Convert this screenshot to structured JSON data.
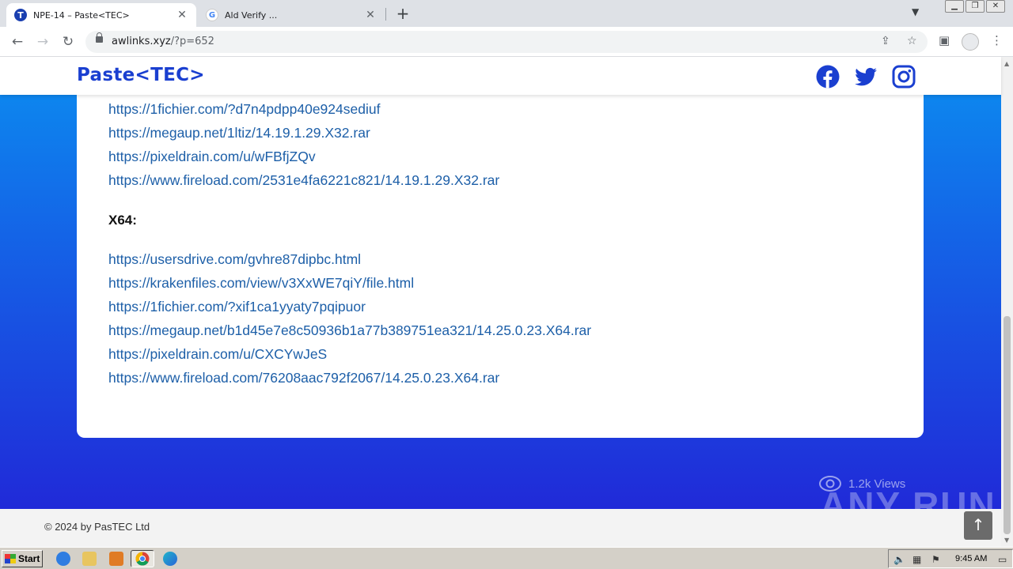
{
  "browser": {
    "tabs": [
      {
        "title": "NPE-14 – Paste<TEC>",
        "favicon": "T",
        "active": true
      },
      {
        "title": "Ald Verify ...",
        "favicon": "G",
        "active": false
      }
    ],
    "new_tab_label": "+",
    "url_host": "awlinks.xyz",
    "url_path": "/?p=652"
  },
  "site": {
    "logo": "Paste<TEC>",
    "brand_color": "#1a3fd0",
    "social": [
      "facebook-icon",
      "twitter-icon",
      "instagram-icon"
    ]
  },
  "content": {
    "links_top": [
      "https://1fichier.com/?d7n4pdpp40e924sediuf",
      "https://megaup.net/1ltiz/14.19.1.29.X32.rar",
      "https://pixeldrain.com/u/wFBfjZQv",
      "https://www.fireload.com/2531e4fa6221c821/14.19.1.29.X32.rar"
    ],
    "heading_x64": "X64:",
    "links_x64": [
      "https://usersdrive.com/gvhre87dipbc.html",
      "https://krakenfiles.com/view/v3XxWE7qiY/file.html",
      "https://1fichier.com/?xif1ca1yyaty7pqipuor",
      "https://megaup.net/b1d45e7e8c50936b1a77b389751ea321/14.25.0.23.X64.rar",
      "https://pixeldrain.com/u/CXCYwJeS",
      "https://www.fireload.com/76208aac792f2067/14.25.0.23.X64.rar"
    ]
  },
  "views_count": "1.2k Views",
  "watermark": "ANY RUN",
  "footer": {
    "copyright": "© 2024 by PasTEC Ltd"
  },
  "taskbar": {
    "start_label": "Start",
    "clock": "9:45 AM"
  }
}
